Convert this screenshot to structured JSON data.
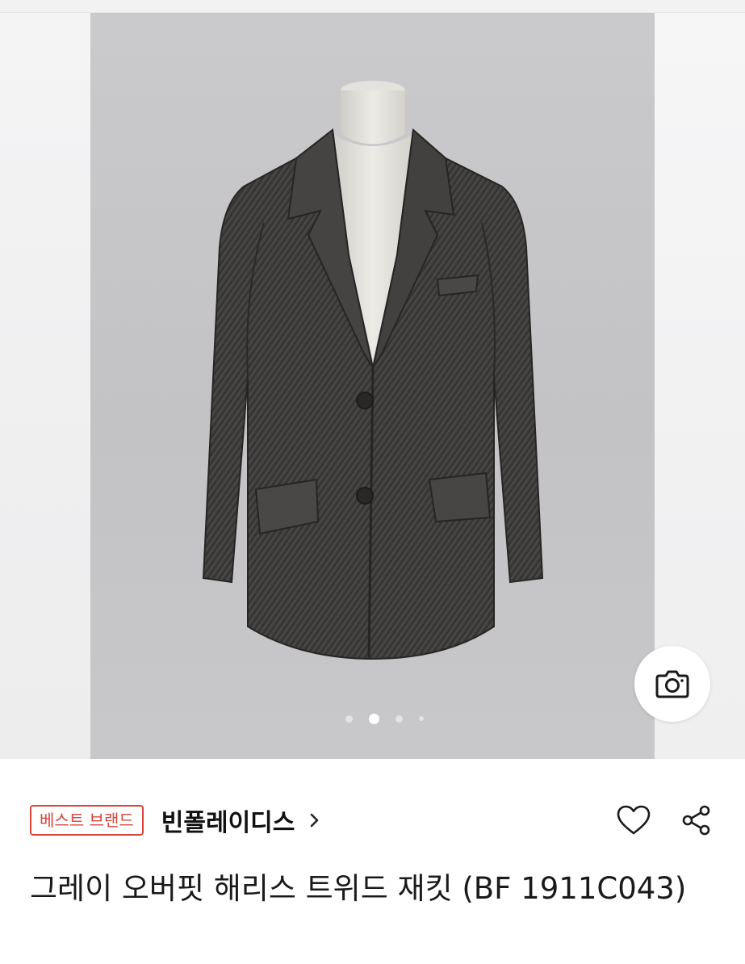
{
  "gallery": {
    "image_icon": "blazer-product-photo",
    "slides_total": 4,
    "active_slide": 2,
    "camera_icon": "camera-icon"
  },
  "product": {
    "badge": "베스트 브랜드",
    "brand": "빈폴레이디스",
    "brand_link_icon": "chevron-right-icon",
    "wishlist_icon": "heart-icon",
    "share_icon": "share-icon",
    "title": "그레이 오버핏 해리스 트위드 재킷 (BF 1911C043)"
  },
  "colors": {
    "badge": "#d8443a",
    "text": "#111111",
    "jacket": "#3d3b39"
  }
}
